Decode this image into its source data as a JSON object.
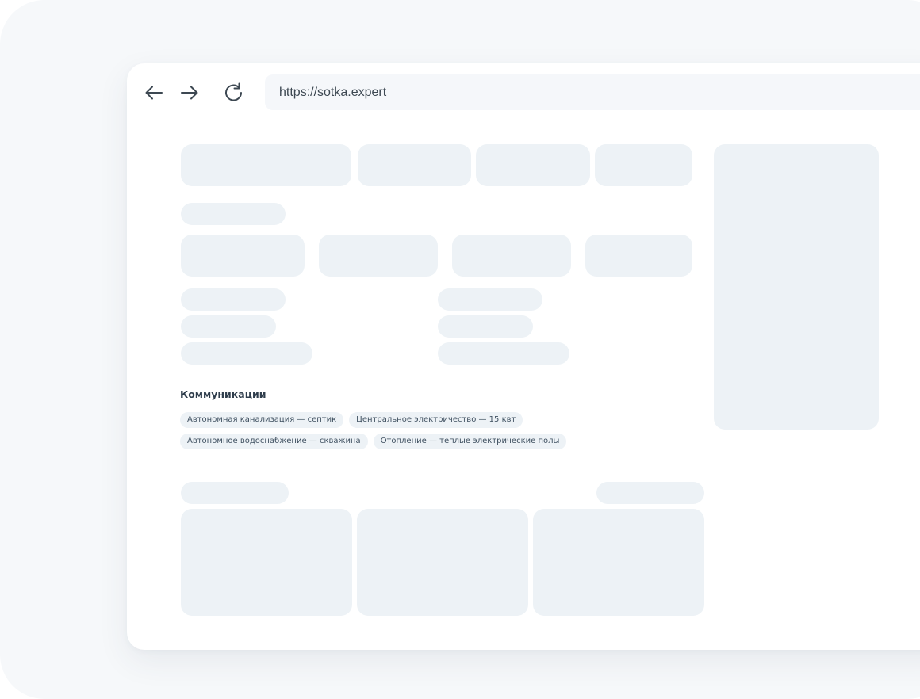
{
  "browser": {
    "url": "https://sotka.expert",
    "back_icon": "arrow-left-icon",
    "forward_icon": "arrow-right-icon",
    "reload_icon": "reload-icon"
  },
  "communications": {
    "title": "Коммуникации",
    "tags": [
      "Автономная канализация — септик",
      "Центральное электричество — 15 квт",
      "Автономное водоснабжение — скважина",
      "Отопление — теплые электрические полы"
    ]
  },
  "colors": {
    "skeleton": "#edf2f6",
    "outer_background": "#f6f8fa",
    "text_dark": "#2f3d4c"
  }
}
